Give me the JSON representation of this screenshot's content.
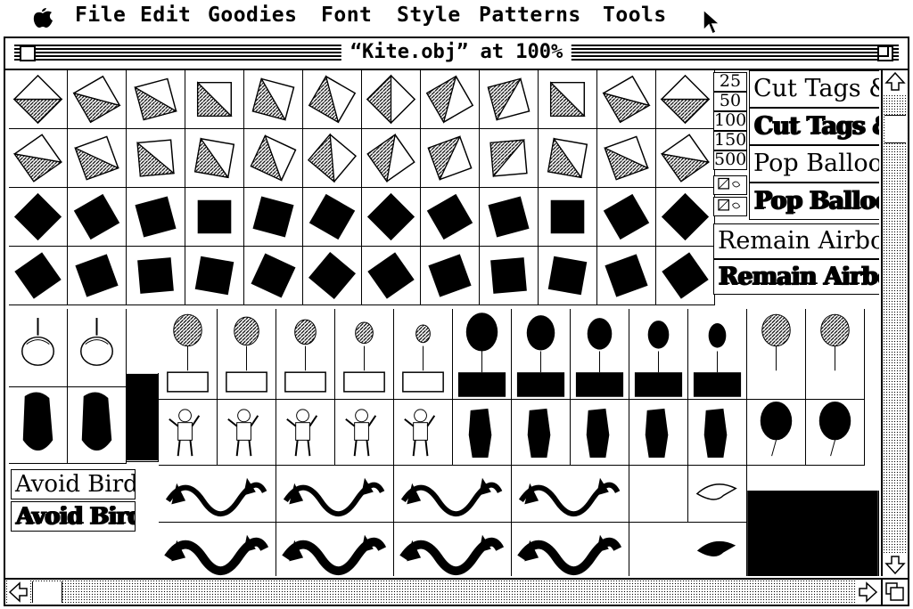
{
  "menubar": {
    "apple_icon": "apple-icon",
    "items": [
      "File",
      "Edit",
      "Goodies",
      "Font",
      "Style",
      "Patterns",
      "Tools"
    ]
  },
  "window": {
    "title": "“Kite.obj” at 100%"
  },
  "zoom_levels": [
    "25",
    "50",
    "100",
    "150",
    "500"
  ],
  "font_samples": {
    "cut_tags": "Cut Tags &",
    "cut_tags_bold": "Cut Tags &",
    "pop_balloon": "Pop Balloon",
    "pop_balloon_bold": "Pop Balloon",
    "remain_airborne": "Remain Airborne",
    "remain_airborne_bold": "Remain Airborne",
    "avoid_bird": "Avoid Bird",
    "avoid_bird_bold": "Avoid Bird"
  },
  "colors": {
    "ink": "#000000",
    "paper": "#ffffff"
  }
}
